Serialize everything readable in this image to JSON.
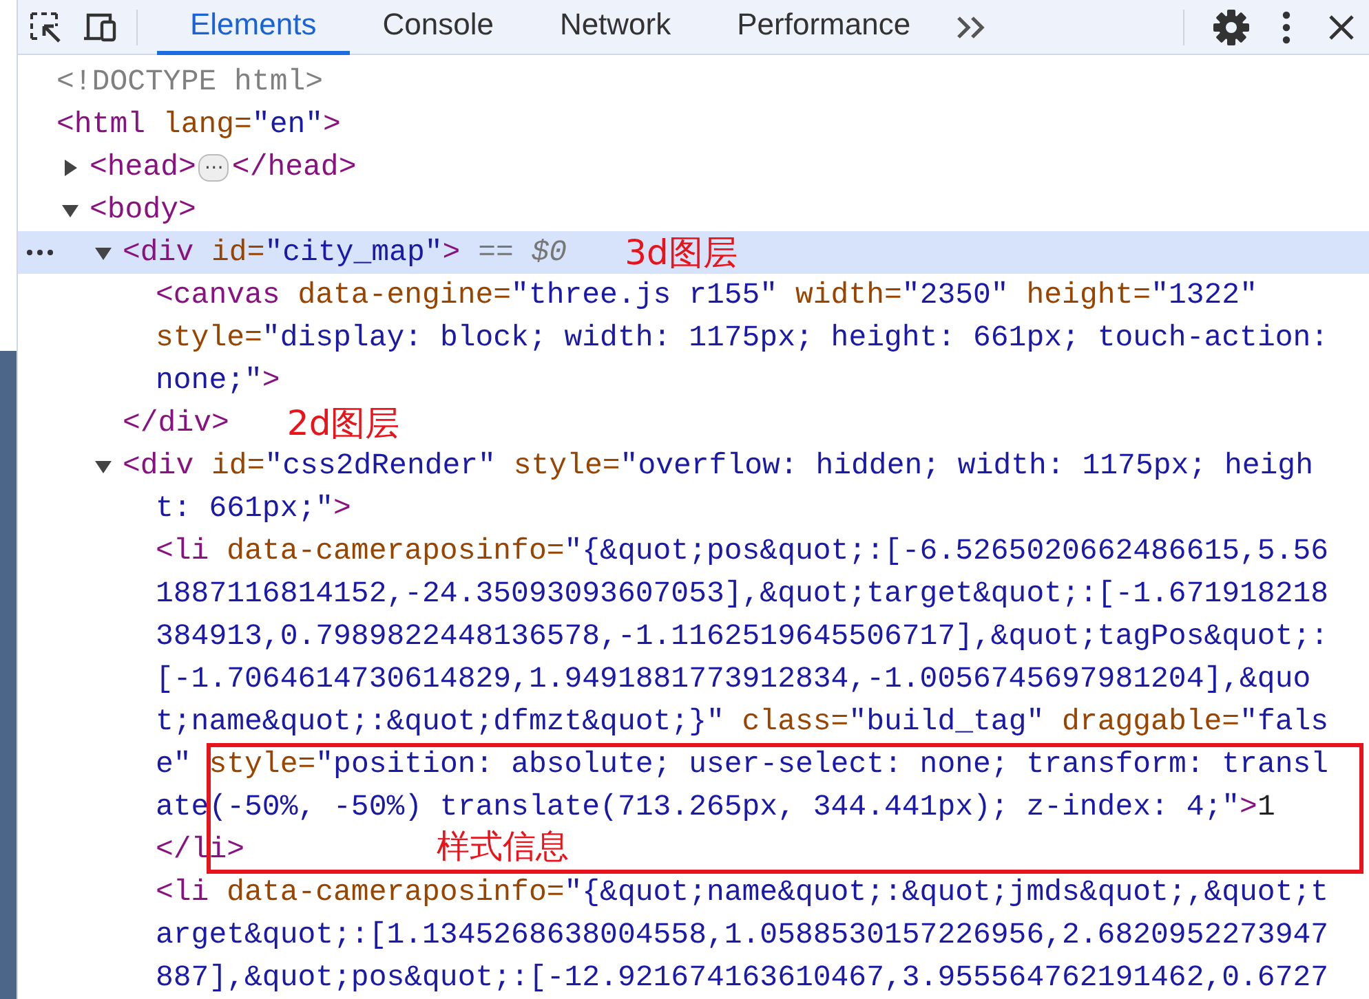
{
  "toolbar": {
    "tabs": [
      {
        "label": "Elements",
        "selected": true
      },
      {
        "label": "Console",
        "selected": false
      },
      {
        "label": "Network",
        "selected": false
      },
      {
        "label": "Performance",
        "selected": false
      }
    ]
  },
  "tree": [
    {
      "selected": false,
      "lines": [
        [
          {
            "kind": "doctype",
            "text": "<!DOCTYPE html>"
          }
        ]
      ]
    },
    {
      "selected": false,
      "lines": [
        [
          {
            "kind": "tag",
            "text": "<html "
          },
          {
            "kind": "attr",
            "text": "lang="
          },
          {
            "kind": "value",
            "text": "\"en\""
          },
          {
            "kind": "tag",
            "text": ">"
          }
        ]
      ],
      "children": [
        {
          "selected": false,
          "expanded": false,
          "lines": [
            [
              {
                "kind": "tag",
                "text": "<head>"
              },
              {
                "kind": "ellipsis",
                "text": "⋯"
              },
              {
                "kind": "tag",
                "text": "</head>"
              }
            ]
          ]
        },
        {
          "selected": false,
          "expanded": true,
          "lines": [
            [
              {
                "kind": "tag",
                "text": "<body>"
              }
            ]
          ],
          "children": [
            {
              "selected": true,
              "expanded": true,
              "annotation": "3d图层",
              "lines": [
                [
                  {
                    "kind": "tag",
                    "text": "<div "
                  },
                  {
                    "kind": "attr",
                    "text": "id="
                  },
                  {
                    "kind": "value",
                    "text": "\"city_map\""
                  },
                  {
                    "kind": "tag",
                    "text": ">"
                  },
                  {
                    "kind": "marker",
                    "text": " == $0"
                  }
                ]
              ],
              "children": [
                {
                  "selected": false,
                  "lines": [
                    [
                      {
                        "kind": "tag",
                        "text": "<canvas "
                      },
                      {
                        "kind": "attr",
                        "text": "data-engine="
                      },
                      {
                        "kind": "value",
                        "text": "\"three.js r155\""
                      },
                      {
                        "kind": "attr",
                        "text": " width="
                      },
                      {
                        "kind": "value",
                        "text": "\"2350\""
                      },
                      {
                        "kind": "attr",
                        "text": " height="
                      },
                      {
                        "kind": "value",
                        "text": "\"1322\""
                      }
                    ],
                    [
                      {
                        "kind": "attr",
                        "text": "style="
                      },
                      {
                        "kind": "value",
                        "text": "\"display: block; width: 1175px; height: 661px; touch-action:"
                      }
                    ],
                    [
                      {
                        "kind": "value",
                        "text": "none;\""
                      },
                      {
                        "kind": "tag",
                        "text": ">"
                      }
                    ]
                  ]
                }
              ],
              "close": [
                {
                  "kind": "tag",
                  "text": "</div>"
                }
              ],
              "close_annotation": "2d图层"
            },
            {
              "selected": false,
              "expanded": true,
              "lines": [
                [
                  {
                    "kind": "tag",
                    "text": "<div "
                  },
                  {
                    "kind": "attr",
                    "text": "id="
                  },
                  {
                    "kind": "value",
                    "text": "\"css2dRender\""
                  },
                  {
                    "kind": "attr",
                    "text": " style="
                  },
                  {
                    "kind": "value",
                    "text": "\"overflow: hidden; width: 1175px; heigh"
                  }
                ],
                [
                  {
                    "kind": "value",
                    "text": "t: 661px;\""
                  },
                  {
                    "kind": "tag",
                    "text": ">"
                  }
                ]
              ],
              "children": [
                {
                  "selected": false,
                  "lines": [
                    [
                      {
                        "kind": "tag",
                        "text": "<li "
                      },
                      {
                        "kind": "attr",
                        "text": "data-cameraposinfo="
                      },
                      {
                        "kind": "value",
                        "text": "\"{&quot;pos&quot;:[-6.5265020662486615,5.56"
                      }
                    ],
                    [
                      {
                        "kind": "value",
                        "text": "1887116814152,-24.35093093607053],&quot;target&quot;:[-1.671918218"
                      }
                    ],
                    [
                      {
                        "kind": "value",
                        "text": "384913,0.7989822448136578,-1.1162519645506717],&quot;tagPos&quot;:"
                      }
                    ],
                    [
                      {
                        "kind": "value",
                        "text": "[-1.7064614730614829,1.9491881773912834,-1.0056745697981204],&quo"
                      }
                    ],
                    [
                      {
                        "kind": "value",
                        "text": "t;name&quot;:&quot;dfmzt&quot;}\""
                      },
                      {
                        "kind": "attr",
                        "text": " class="
                      },
                      {
                        "kind": "value",
                        "text": "\"build_tag\""
                      },
                      {
                        "kind": "attr",
                        "text": " draggable="
                      },
                      {
                        "kind": "value",
                        "text": "\"fals"
                      }
                    ],
                    [
                      {
                        "kind": "value",
                        "text": "e\""
                      },
                      {
                        "kind": "attr",
                        "text": " style="
                      },
                      {
                        "kind": "value",
                        "text": "\"position: absolute; user-select: none; transform: transl"
                      }
                    ],
                    [
                      {
                        "kind": "value",
                        "text": "ate(-50%, -50%) translate(713.265px, 344.441px); z-index: 4;\""
                      },
                      {
                        "kind": "tag",
                        "text": ">"
                      },
                      {
                        "kind": "text",
                        "text": "1"
                      }
                    ]
                  ],
                  "close": [
                    {
                      "kind": "tag",
                      "text": "</li>"
                    }
                  ]
                },
                {
                  "selected": false,
                  "lines": [
                    [
                      {
                        "kind": "tag",
                        "text": "<li "
                      },
                      {
                        "kind": "attr",
                        "text": "data-cameraposinfo="
                      },
                      {
                        "kind": "value",
                        "text": "\"{&quot;name&quot;:&quot;jmds&quot;,&quot;t"
                      }
                    ],
                    [
                      {
                        "kind": "value",
                        "text": "arget&quot;:[1.1345268638004558,1.0588530157226956,2.6820952273947"
                      }
                    ],
                    [
                      {
                        "kind": "value",
                        "text": "887],&quot;pos&quot;:[-12.921674163610467,3.955564762191462,0.6727"
                      }
                    ]
                  ]
                }
              ]
            }
          ]
        }
      ]
    }
  ],
  "callout": {
    "label": "样式信息"
  }
}
